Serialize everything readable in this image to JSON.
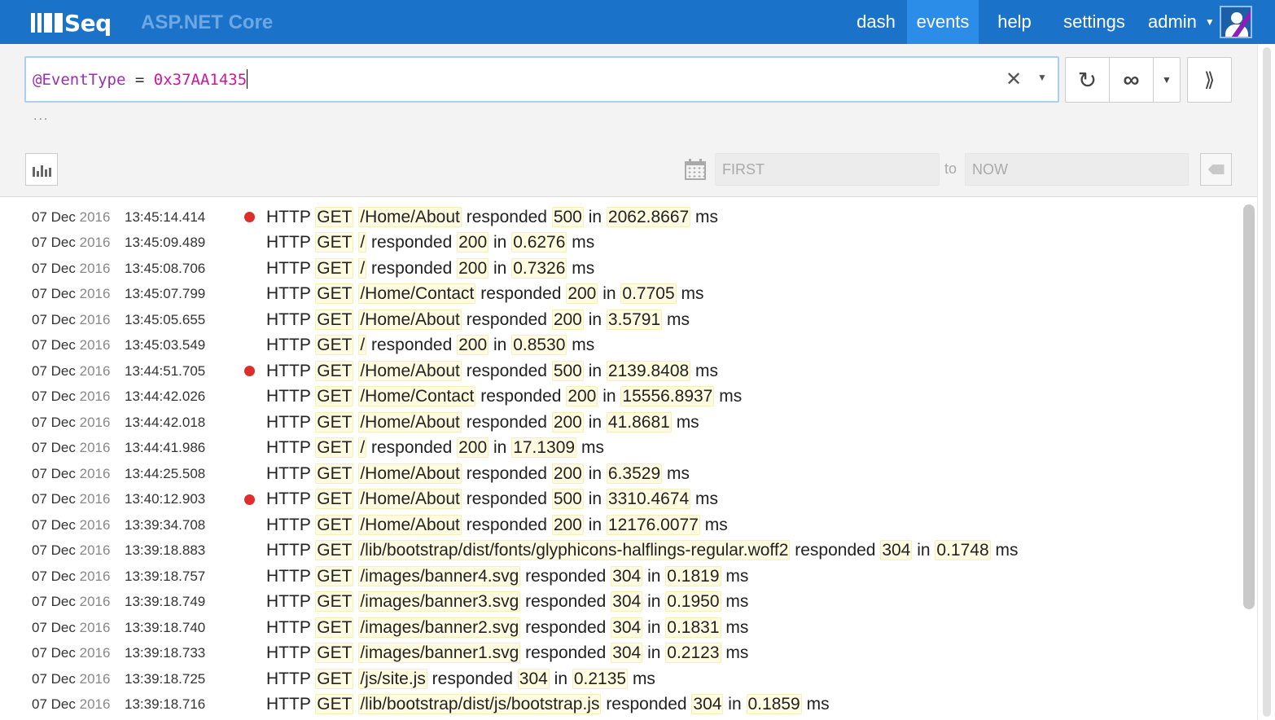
{
  "app": {
    "logo_text": "Seq",
    "app_name": "ASP.NET Core"
  },
  "nav": {
    "items": [
      {
        "label": "dash"
      },
      {
        "label": "events"
      },
      {
        "label": "help"
      },
      {
        "label": "settings"
      }
    ],
    "user": "admin",
    "active": "events"
  },
  "search": {
    "property": "@EventType",
    "operator": "=",
    "value": "0x37AA1435",
    "more_indicator": "..."
  },
  "range": {
    "from_placeholder": "FIRST",
    "to_label": "to",
    "to_placeholder": "NOW"
  },
  "colors": {
    "topbar": "#1a73c8",
    "active_nav": "#2c8de8",
    "error_level": "#dd2e2e",
    "token_highlight": "#fffbe0",
    "query_property": "#9b2fb0",
    "query_value": "#d8129a"
  },
  "events": [
    {
      "day": "07 Dec",
      "year": "2016",
      "time": "13:45:14.414",
      "error": true,
      "path": "/Home/About",
      "status": "500",
      "elapsed": "2062.8667"
    },
    {
      "day": "07 Dec",
      "year": "2016",
      "time": "13:45:09.489",
      "error": false,
      "path": "/",
      "status": "200",
      "elapsed": "0.6276"
    },
    {
      "day": "07 Dec",
      "year": "2016",
      "time": "13:45:08.706",
      "error": false,
      "path": "/",
      "status": "200",
      "elapsed": "0.7326"
    },
    {
      "day": "07 Dec",
      "year": "2016",
      "time": "13:45:07.799",
      "error": false,
      "path": "/Home/Contact",
      "status": "200",
      "elapsed": "0.7705"
    },
    {
      "day": "07 Dec",
      "year": "2016",
      "time": "13:45:05.655",
      "error": false,
      "path": "/Home/About",
      "status": "200",
      "elapsed": "3.5791"
    },
    {
      "day": "07 Dec",
      "year": "2016",
      "time": "13:45:03.549",
      "error": false,
      "path": "/",
      "status": "200",
      "elapsed": "0.8530"
    },
    {
      "day": "07 Dec",
      "year": "2016",
      "time": "13:44:51.705",
      "error": true,
      "path": "/Home/About",
      "status": "500",
      "elapsed": "2139.8408"
    },
    {
      "day": "07 Dec",
      "year": "2016",
      "time": "13:44:42.026",
      "error": false,
      "path": "/Home/Contact",
      "status": "200",
      "elapsed": "15556.8937"
    },
    {
      "day": "07 Dec",
      "year": "2016",
      "time": "13:44:42.018",
      "error": false,
      "path": "/Home/About",
      "status": "200",
      "elapsed": "41.8681"
    },
    {
      "day": "07 Dec",
      "year": "2016",
      "time": "13:44:41.986",
      "error": false,
      "path": "/",
      "status": "200",
      "elapsed": "17.1309"
    },
    {
      "day": "07 Dec",
      "year": "2016",
      "time": "13:44:25.508",
      "error": false,
      "path": "/Home/About",
      "status": "200",
      "elapsed": "6.3529"
    },
    {
      "day": "07 Dec",
      "year": "2016",
      "time": "13:40:12.903",
      "error": true,
      "path": "/Home/About",
      "status": "500",
      "elapsed": "3310.4674"
    },
    {
      "day": "07 Dec",
      "year": "2016",
      "time": "13:39:34.708",
      "error": false,
      "path": "/Home/About",
      "status": "200",
      "elapsed": "12176.0077"
    },
    {
      "day": "07 Dec",
      "year": "2016",
      "time": "13:39:18.883",
      "error": false,
      "path": "/lib/bootstrap/dist/fonts/glyphicons-halflings-regular.woff2",
      "status": "304",
      "elapsed": "0.1748"
    },
    {
      "day": "07 Dec",
      "year": "2016",
      "time": "13:39:18.757",
      "error": false,
      "path": "/images/banner4.svg",
      "status": "304",
      "elapsed": "0.1819"
    },
    {
      "day": "07 Dec",
      "year": "2016",
      "time": "13:39:18.749",
      "error": false,
      "path": "/images/banner3.svg",
      "status": "304",
      "elapsed": "0.1950"
    },
    {
      "day": "07 Dec",
      "year": "2016",
      "time": "13:39:18.740",
      "error": false,
      "path": "/images/banner2.svg",
      "status": "304",
      "elapsed": "0.1831"
    },
    {
      "day": "07 Dec",
      "year": "2016",
      "time": "13:39:18.733",
      "error": false,
      "path": "/images/banner1.svg",
      "status": "304",
      "elapsed": "0.2123"
    },
    {
      "day": "07 Dec",
      "year": "2016",
      "time": "13:39:18.725",
      "error": false,
      "path": "/js/site.js",
      "status": "304",
      "elapsed": "0.2135"
    },
    {
      "day": "07 Dec",
      "year": "2016",
      "time": "13:39:18.716",
      "error": false,
      "path": "/lib/bootstrap/dist/js/bootstrap.js",
      "status": "304",
      "elapsed": "0.1859"
    }
  ],
  "message_parts": {
    "prefix": "HTTP",
    "method": "GET",
    "responded": "responded",
    "in": "in",
    "unit": "ms"
  }
}
